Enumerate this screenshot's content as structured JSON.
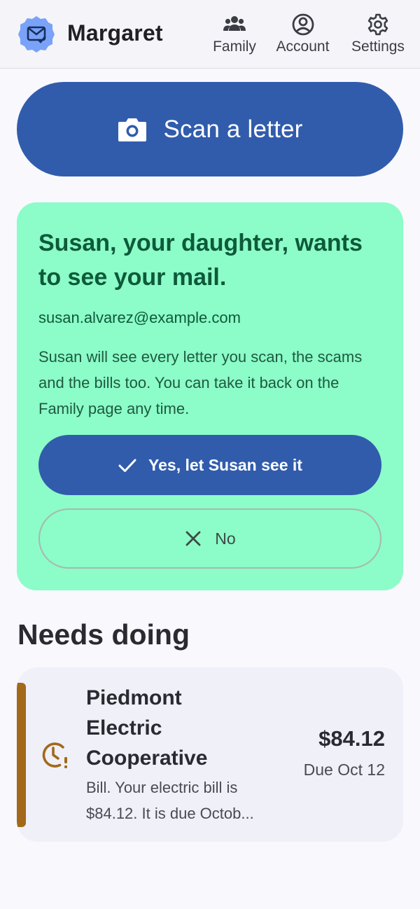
{
  "header": {
    "user_name": "Margaret",
    "nav": [
      {
        "label": "Family",
        "icon": "family-icon"
      },
      {
        "label": "Account",
        "icon": "account-icon"
      },
      {
        "label": "Settings",
        "icon": "settings-icon"
      }
    ]
  },
  "scan": {
    "label": "Scan a letter",
    "icon": "camera-icon"
  },
  "invite": {
    "title": "Susan, your daughter, wants to see your mail.",
    "email": "susan.alvarez@example.com",
    "body": "Susan will see every letter you scan, the scams and the bills too. You can take it back on the Family page any time.",
    "accept_label": "Yes, let Susan see it",
    "decline_label": "No"
  },
  "needs_doing": {
    "title": "Needs doing",
    "items": [
      {
        "title": "Piedmont Electric Cooperative",
        "description": "Bill. Your electric bill is $84.12. It is due Octob...",
        "amount": "$84.12",
        "due": "Due Oct 12",
        "icon": "clock-alert-icon"
      }
    ]
  },
  "colors": {
    "primary": "#315cac",
    "invite_bg": "#8cfcc8",
    "invite_text": "#0d5a3a",
    "bill_accent": "#a2691a",
    "page_bg": "#f8f8fd"
  }
}
